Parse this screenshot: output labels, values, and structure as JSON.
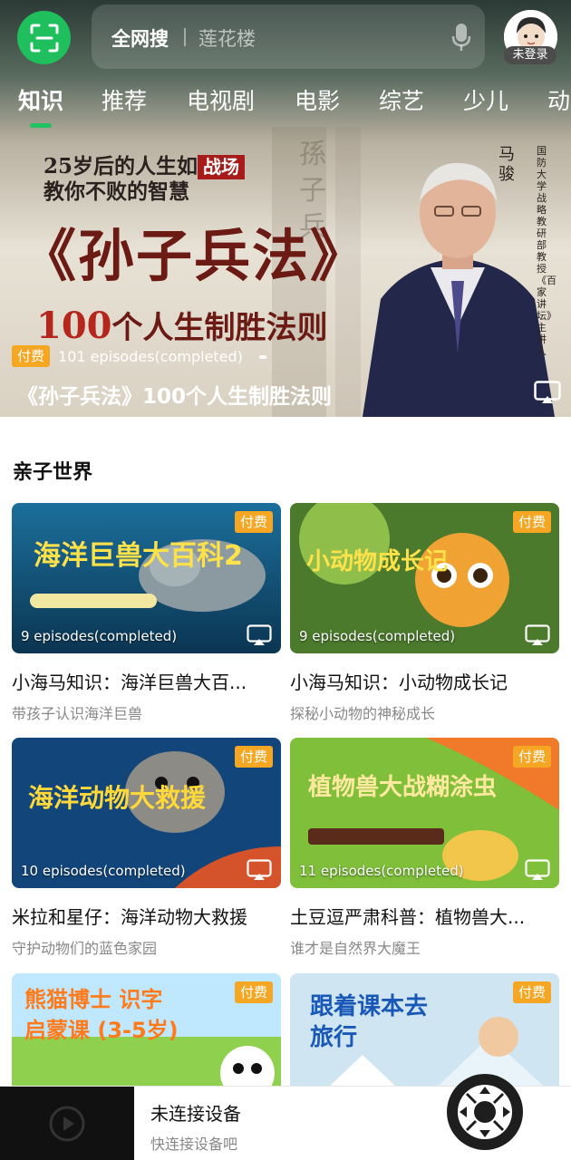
{
  "header": {
    "search_scope": "全网搜",
    "search_placeholder": "莲花楼",
    "login_badge": "未登录"
  },
  "tabs": [
    {
      "label": "知识",
      "active": true
    },
    {
      "label": "推荐"
    },
    {
      "label": "电视剧"
    },
    {
      "label": "电影"
    },
    {
      "label": "综艺"
    },
    {
      "label": "少儿"
    },
    {
      "label": "动"
    }
  ],
  "hero": {
    "headline_line1": "25岁后的人生如",
    "headline_box": "战场",
    "headline_line2": "教你不败的智慧",
    "book_title": "《孙子兵法》",
    "rules_num": "100",
    "rules_text": "个人生制胜法则",
    "lecturer_name": "马骏",
    "lecturer_title": "国防大学战略教研部教授《百家讲坛》主讲人",
    "paid_tag": "付费",
    "episodes": "101 episodes(completed)",
    "title": "《孙子兵法》100个人生制胜法则"
  },
  "section": {
    "title": "亲子世界",
    "cards": [
      {
        "title": "小海马知识：海洋巨兽大百...",
        "subtitle": "带孩子认识海洋巨兽",
        "episodes": "9 episodes(completed)",
        "paid_tag": "付费",
        "art_label": "海洋巨兽大百科2"
      },
      {
        "title": "小海马知识：小动物成长记",
        "subtitle": "探秘小动物的神秘成长",
        "episodes": "9 episodes(completed)",
        "paid_tag": "付费",
        "art_label": "小动物成长记"
      },
      {
        "title": "米拉和星仔：海洋动物大救援",
        "subtitle": "守护动物们的蓝色家园",
        "episodes": "10 episodes(completed)",
        "paid_tag": "付费",
        "art_label": "海洋动物大救援"
      },
      {
        "title": "土豆逗严肃科普：植物兽大...",
        "subtitle": "谁才是自然界大魔王",
        "episodes": "11 episodes(completed)",
        "paid_tag": "付费",
        "art_label": "植物兽大战糊涂虫"
      },
      {
        "title": "",
        "subtitle": "",
        "episodes": "",
        "paid_tag": "付费",
        "art_label": "熊猫博士 识字启蒙课 (3-5岁)"
      },
      {
        "title": "",
        "subtitle": "",
        "episodes": "",
        "paid_tag": "付费",
        "art_label": "跟着课本去旅行"
      }
    ]
  },
  "bottom_bar": {
    "status": "未连接设备",
    "hint": "快连接设备吧"
  },
  "colors": {
    "accent_green": "#20c35f",
    "paid_orange": "#f5a623"
  },
  "icons": [
    "scan-icon",
    "mic-icon",
    "avatar-icon",
    "cast-icon",
    "play-icon",
    "remote-control-icon"
  ]
}
